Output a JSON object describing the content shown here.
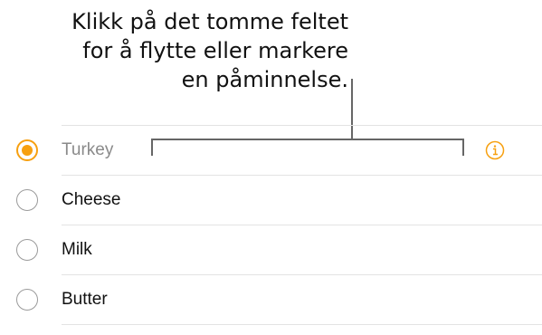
{
  "callout": {
    "line1": "Klikk på det tomme feltet",
    "line2": "for å flytte eller markere",
    "line3": "en påminnelse."
  },
  "reminders": [
    {
      "title": "Turkey",
      "selected": true,
      "editing": true
    },
    {
      "title": "Cheese",
      "selected": false,
      "editing": false
    },
    {
      "title": "Milk",
      "selected": false,
      "editing": false
    },
    {
      "title": "Butter",
      "selected": false,
      "editing": false
    }
  ],
  "icons": {
    "radio": "radio-circle-icon",
    "info": "info-icon"
  },
  "colors": {
    "accent": "#f7a010",
    "muted_text": "#8a8a8a",
    "divider": "#e3e3e3",
    "radio_border": "#9a9a9a",
    "pointer": "#666666"
  }
}
